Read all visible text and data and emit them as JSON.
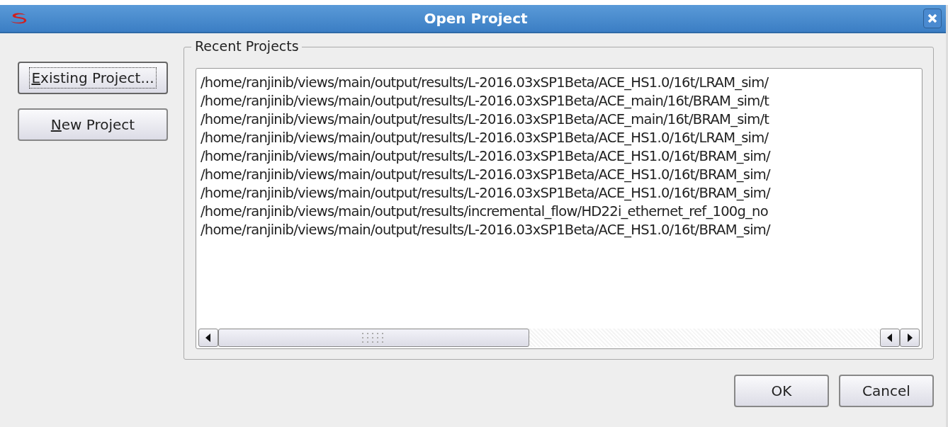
{
  "window": {
    "title": "Open Project"
  },
  "side_buttons": [
    {
      "label": "Existing Project...",
      "focused": true
    },
    {
      "label": "New Project",
      "focused": false
    }
  ],
  "recent_projects": {
    "title": "Recent Projects",
    "items": [
      "/home/ranjinib/views/main/output/results/L-2016.03xSP1Beta/ACE_HS1.0/16t/LRAM_sim/",
      "/home/ranjinib/views/main/output/results/L-2016.03xSP1Beta/ACE_main/16t/BRAM_sim/t",
      "/home/ranjinib/views/main/output/results/L-2016.03xSP1Beta/ACE_main/16t/BRAM_sim/t",
      "/home/ranjinib/views/main/output/results/L-2016.03xSP1Beta/ACE_HS1.0/16t/LRAM_sim/",
      "/home/ranjinib/views/main/output/results/L-2016.03xSP1Beta/ACE_HS1.0/16t/BRAM_sim/",
      "/home/ranjinib/views/main/output/results/L-2016.03xSP1Beta/ACE_HS1.0/16t/BRAM_sim/",
      "/home/ranjinib/views/main/output/results/L-2016.03xSP1Beta/ACE_HS1.0/16t/BRAM_sim/",
      "/home/ranjinib/views/main/output/results/incremental_flow/HD22i_ethernet_ref_100g_no",
      "/home/ranjinib/views/main/output/results/L-2016.03xSP1Beta/ACE_HS1.0/16t/BRAM_sim/"
    ]
  },
  "buttons": [
    "OK",
    "Cancel"
  ]
}
